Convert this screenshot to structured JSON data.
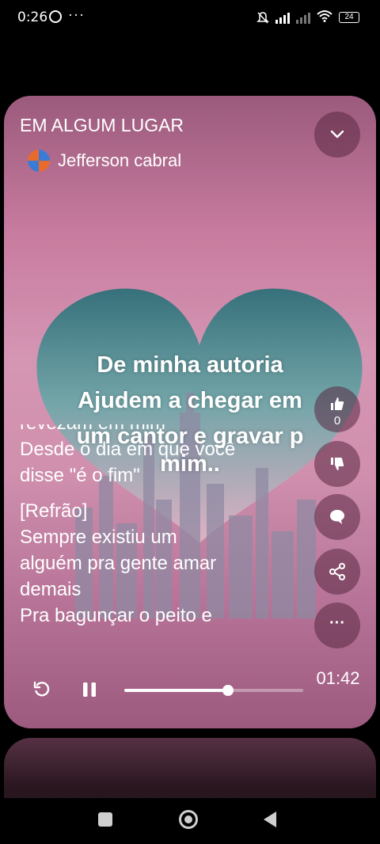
{
  "status_bar": {
    "time": "0:26",
    "more": "···",
    "battery": "24"
  },
  "player": {
    "title": "EM ALGUM LUGAR",
    "artist": "Jefferson cabral",
    "overlay_text": [
      "De minha autoria",
      "Ajudem a chegar em",
      "um cantor e gravar p",
      "mim.."
    ],
    "lyrics": {
      "partial_top": "revezam em mim",
      "line1": "Desde o dia em que você",
      "line2": "disse \"é o fim\"",
      "section": "[Refrão]",
      "chorus": [
        "Sempre existiu um",
        "alguém pra gente amar",
        "demais",
        "Pra bagunçar o peito e"
      ]
    },
    "likes": "0",
    "more_label": "···",
    "time_display": "01:42",
    "progress": 0.58
  },
  "icons": {
    "collapse": "chevron-down-icon",
    "like": "thumbs-up-icon",
    "dislike": "thumbs-down-icon",
    "comment": "comment-icon",
    "share": "share-icon",
    "more": "more-icon",
    "replay": "replay-icon",
    "pause": "pause-icon"
  },
  "colors": {
    "card_pink": "#d596b4",
    "button_bg": "#5a2841"
  }
}
